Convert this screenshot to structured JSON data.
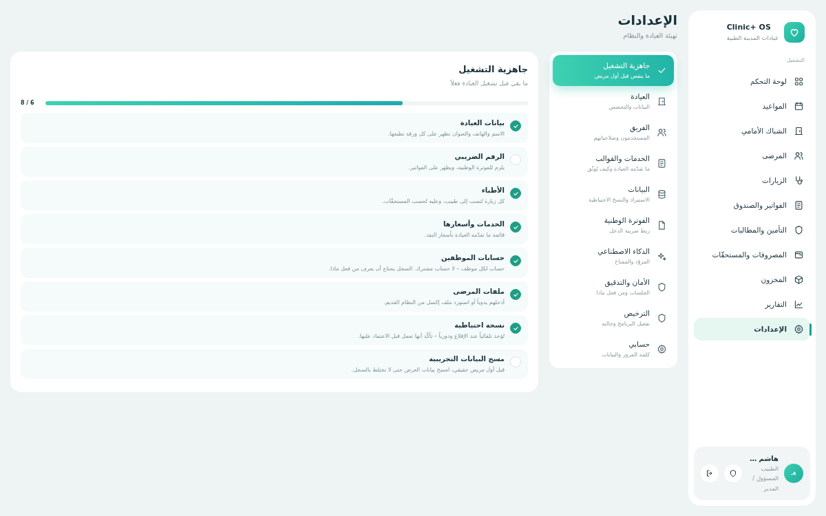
{
  "brand": {
    "name": "Clinic+ OS",
    "subtitle": "عيادات المدينة الطبية"
  },
  "sidebar": {
    "section_label": "التشغيل",
    "items": [
      {
        "label": "لوحة التحكم",
        "selected": false
      },
      {
        "label": "المواعيد",
        "selected": false
      },
      {
        "label": "الشباك الأمامي",
        "selected": false
      },
      {
        "label": "المرضى",
        "selected": false
      },
      {
        "label": "الزيارات",
        "selected": false
      },
      {
        "label": "الفواتير والصندوق",
        "selected": false
      },
      {
        "label": "التأمين والمطالبات",
        "selected": false
      },
      {
        "label": "المصروفات والمستحقّات",
        "selected": false
      },
      {
        "label": "المخزون",
        "selected": false
      },
      {
        "label": "التقارير",
        "selected": false
      },
      {
        "label": "الإعدادات",
        "selected": true
      }
    ]
  },
  "user": {
    "avatar": "هـ",
    "name": "هاشم …",
    "role": "الطبيب المسؤول / المدير"
  },
  "page": {
    "title": "الإعدادات",
    "subtitle": "تهيئة العيادة والنظام"
  },
  "settings_nav": [
    {
      "title": "جاهزية التشغيل",
      "subtitle": "ما ينقص قبل أول مريض",
      "selected": true
    },
    {
      "title": "العيادة",
      "subtitle": "البيانات والتخصص",
      "selected": false
    },
    {
      "title": "الفريق",
      "subtitle": "المستخدمون وصلاحياتهم",
      "selected": false
    },
    {
      "title": "الخدمات والقوالب",
      "subtitle": "ما تقدّمه العيادة وكيف يُوثّق",
      "selected": false
    },
    {
      "title": "البيانات",
      "subtitle": "الاستيراد والنسخ الاحتياطية",
      "selected": false
    },
    {
      "title": "الفوترة الوطنية",
      "subtitle": "ربط ضريبة الدخل",
      "selected": false
    },
    {
      "title": "الذكاء الاصطناعي",
      "subtitle": "المزوّد والمفتاح",
      "selected": false
    },
    {
      "title": "الأمان والتدقيق",
      "subtitle": "الجلسات ومن فعل ماذا",
      "selected": false
    },
    {
      "title": "الترخيص",
      "subtitle": "تفعيل البرنامج وحالته",
      "selected": false
    },
    {
      "title": "حسابي",
      "subtitle": "كلمة المرور والبيانات",
      "selected": false
    }
  ],
  "readiness": {
    "title": "جاهزية التشغيل",
    "subtitle": "ما بقي قبل تشغيل العيادة فعلاً",
    "progress_text": "6 / 8",
    "level": 0.74,
    "items": [
      {
        "title": "بيانات العيادة",
        "description": "الاسم والهاتف والعنوان تظهر على كل ورقة تطبعها.",
        "checked": true
      },
      {
        "title": "الرقم الضريبي",
        "description": "يلزم للفوترة الوطنية، ويظهر على الفواتير.",
        "checked": false
      },
      {
        "title": "الأطباء",
        "description": "كل زيارة تُنسب إلى طبيب، وعليه تُحسب المستحقّات.",
        "checked": true
      },
      {
        "title": "الخدمات وأسعارها",
        "description": "قائمة ما تقدّمه العيادة بأسعار النقد.",
        "checked": true
      },
      {
        "title": "حسابات الموظفين",
        "description": "حساب لكل موظف – لا حساب مشترك. السجل يحتاج أن يعرف من فعل ماذا.",
        "checked": true
      },
      {
        "title": "ملفات المرضى",
        "description": "أدخلهم يدوياً أو استورد ملف إكسل من النظام القديم.",
        "checked": true
      },
      {
        "title": "نسخة احتياطية",
        "description": "تُؤخذ تلقائياً عند الإقلاع ودورياً – تأكّد أنها تعمل قبل الاعتماد عليها.",
        "checked": true
      },
      {
        "title": "مسح البيانات التجريبية",
        "description": "قبل أول مريض حقيقي، امسح بيانات العرض حتى لا تختلط بالسجل.",
        "checked": false
      }
    ]
  }
}
